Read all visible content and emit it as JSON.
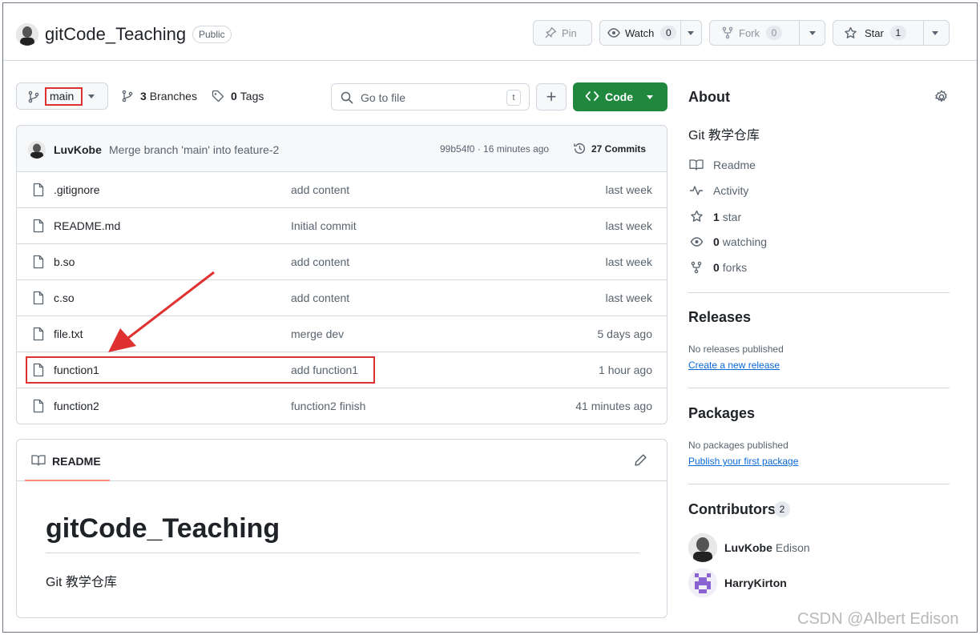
{
  "repo": {
    "name": "gitCode_Teaching",
    "visibility": "Public"
  },
  "header_actions": {
    "pin": "Pin",
    "watch": {
      "label": "Watch",
      "count": "0"
    },
    "fork": {
      "label": "Fork",
      "count": "0"
    },
    "star": {
      "label": "Star",
      "count": "1"
    }
  },
  "toolbar": {
    "branch": "main",
    "branches_count": "3",
    "branches_label": "Branches",
    "tags_count": "0",
    "tags_label": "Tags",
    "search_placeholder": "Go to file",
    "search_shortcut": "t",
    "code_label": "Code"
  },
  "latest_commit": {
    "author": "LuvKobe",
    "message": "Merge branch 'main' into feature-2",
    "hash_time": "99b54f0 · 16 minutes ago",
    "commits_label": "27 Commits"
  },
  "files": [
    {
      "name": ".gitignore",
      "message": "add content",
      "time": "last week"
    },
    {
      "name": "README.md",
      "message": "Initial commit",
      "time": "last week"
    },
    {
      "name": "b.so",
      "message": "add content",
      "time": "last week"
    },
    {
      "name": "c.so",
      "message": "add content",
      "time": "last week"
    },
    {
      "name": "file.txt",
      "message": "merge dev",
      "time": "5 days ago"
    },
    {
      "name": "function1",
      "message": "add function1",
      "time": "1 hour ago"
    },
    {
      "name": "function2",
      "message": "function2 finish",
      "time": "41 minutes ago"
    }
  ],
  "readme": {
    "tab_label": "README",
    "heading": "gitCode_Teaching",
    "body": "Git 教学仓库"
  },
  "about": {
    "title": "About",
    "description": "Git 教学仓库",
    "items": [
      {
        "icon": "book-icon",
        "bold": "",
        "label": "Readme"
      },
      {
        "icon": "pulse-icon",
        "bold": "",
        "label": "Activity"
      },
      {
        "icon": "star-icon",
        "bold": "1",
        "label": "star"
      },
      {
        "icon": "eye-icon",
        "bold": "0",
        "label": "watching"
      },
      {
        "icon": "fork-icon",
        "bold": "0",
        "label": "forks"
      }
    ]
  },
  "releases": {
    "title": "Releases",
    "empty": "No releases published",
    "link": "Create a new release"
  },
  "packages": {
    "title": "Packages",
    "empty": "No packages published",
    "link": "Publish your first package"
  },
  "contributors": {
    "title": "Contributors",
    "count": "2",
    "people": [
      {
        "login": "LuvKobe",
        "name": "Edison"
      },
      {
        "login": "HarryKirton",
        "name": ""
      }
    ]
  },
  "watermark": "CSDN @Albert Edison",
  "colors": {
    "primary_button": "#1f883d",
    "link": "#0969da",
    "annotation_red": "#e03131",
    "tab_underline": "#fd8c73"
  }
}
